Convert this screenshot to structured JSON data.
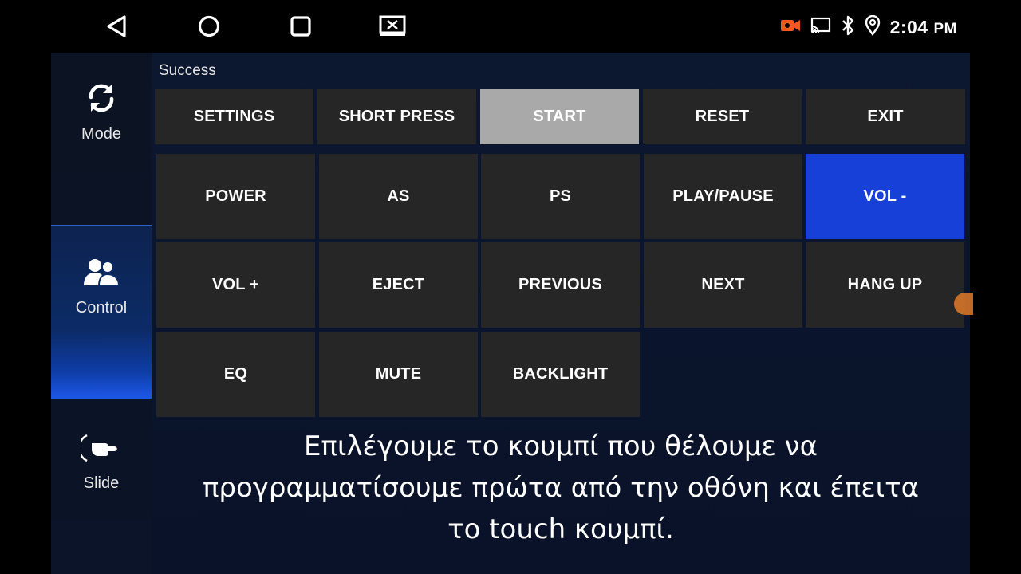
{
  "statusbar": {
    "nav": [
      "back-icon",
      "home-icon",
      "recents-icon",
      "screencast-icon"
    ],
    "indicators": [
      "camera-record-icon",
      "cast-icon",
      "bluetooth-icon",
      "location-icon"
    ],
    "time": "2:04",
    "ampm": "PM"
  },
  "sidebar": {
    "items": [
      {
        "label": "Mode",
        "icon": "refresh-icon"
      },
      {
        "label": "Control",
        "icon": "users-icon",
        "active": true
      },
      {
        "label": "Slide",
        "icon": "swipe-hand-icon"
      }
    ]
  },
  "main": {
    "status": "Success",
    "top_buttons": [
      "SETTINGS",
      "SHORT PRESS",
      "START",
      "RESET",
      "EXIT"
    ],
    "keys": [
      "POWER",
      "AS",
      "PS",
      "PLAY/PAUSE",
      "VOL -",
      "VOL +",
      "EJECT",
      "PREVIOUS",
      "NEXT",
      "HANG UP",
      "EQ",
      "MUTE",
      "BACKLIGHT"
    ],
    "pressed_top_button": "START",
    "selected_key": "VOL -"
  },
  "subtitle": {
    "lines": [
      "Επιλέγουμε το κουμπί που θέλουμε να",
      "προγραμματίσουμε πρώτα από την οθόνη και έπειτα",
      "το touch κουμπί."
    ]
  },
  "colors": {
    "key_bg": "#262626",
    "pressed_bg": "#a9a9a9",
    "selected_bg": "#1740d8",
    "sidebar_active": "#1d57e8"
  }
}
